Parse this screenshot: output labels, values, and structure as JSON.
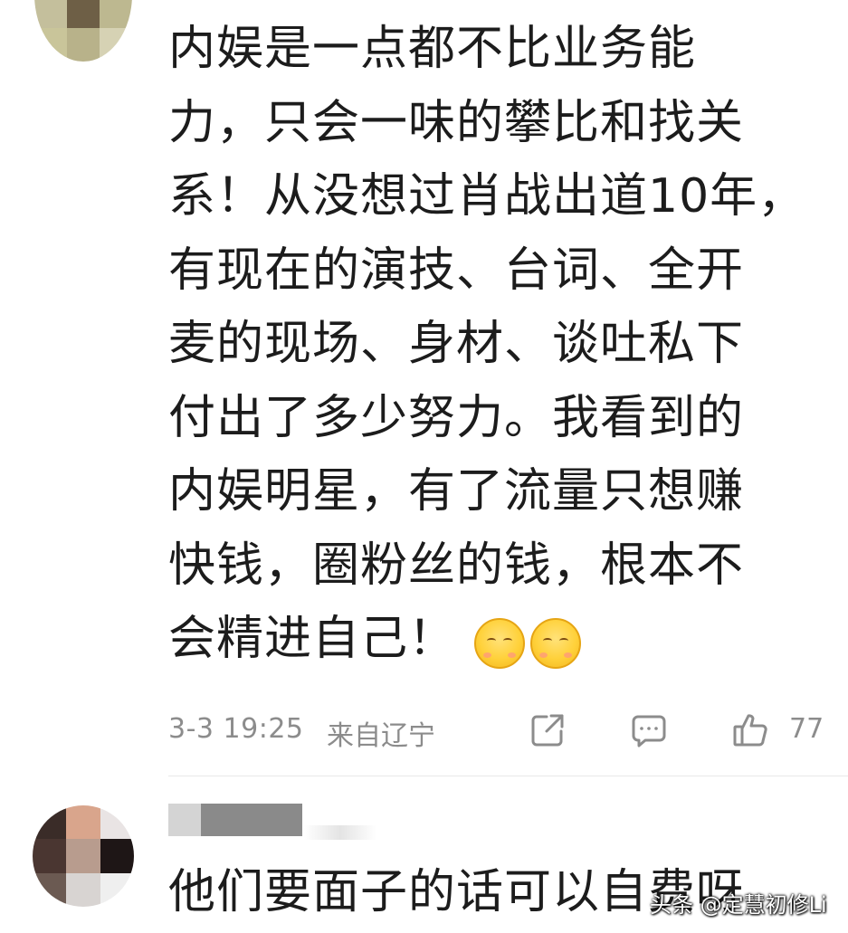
{
  "comment1": {
    "lines": [
      "内娱是一点都不比业务能",
      "力，只会一味的攀比和找关",
      "系！从没想过肖战出道10年，",
      "有现在的演技、台词、全开",
      "麦的现场、身材、谈吐私下",
      "付出了多少努力。我看到的",
      "内娱明星，有了流量只想赚",
      "快钱，圈粉丝的钱，根本不",
      "会精进自己！"
    ],
    "emoji_icons": [
      "blush-emoji",
      "blush-emoji"
    ],
    "time": "3-3 19:25",
    "location": "来自辽宁",
    "like_count": "77",
    "icons": {
      "share": "share-icon",
      "reply": "comment-icon",
      "like": "thumbs-up-icon"
    }
  },
  "comment2": {
    "text": "他们要面子的话可以自费呀"
  },
  "watermark": {
    "text": "头条 @定慧初修Li"
  },
  "colors": {
    "text": "#1c1c1c",
    "meta": "#8c8c8c",
    "divider": "#e8e8e8",
    "emoji": "#ffd13a"
  }
}
